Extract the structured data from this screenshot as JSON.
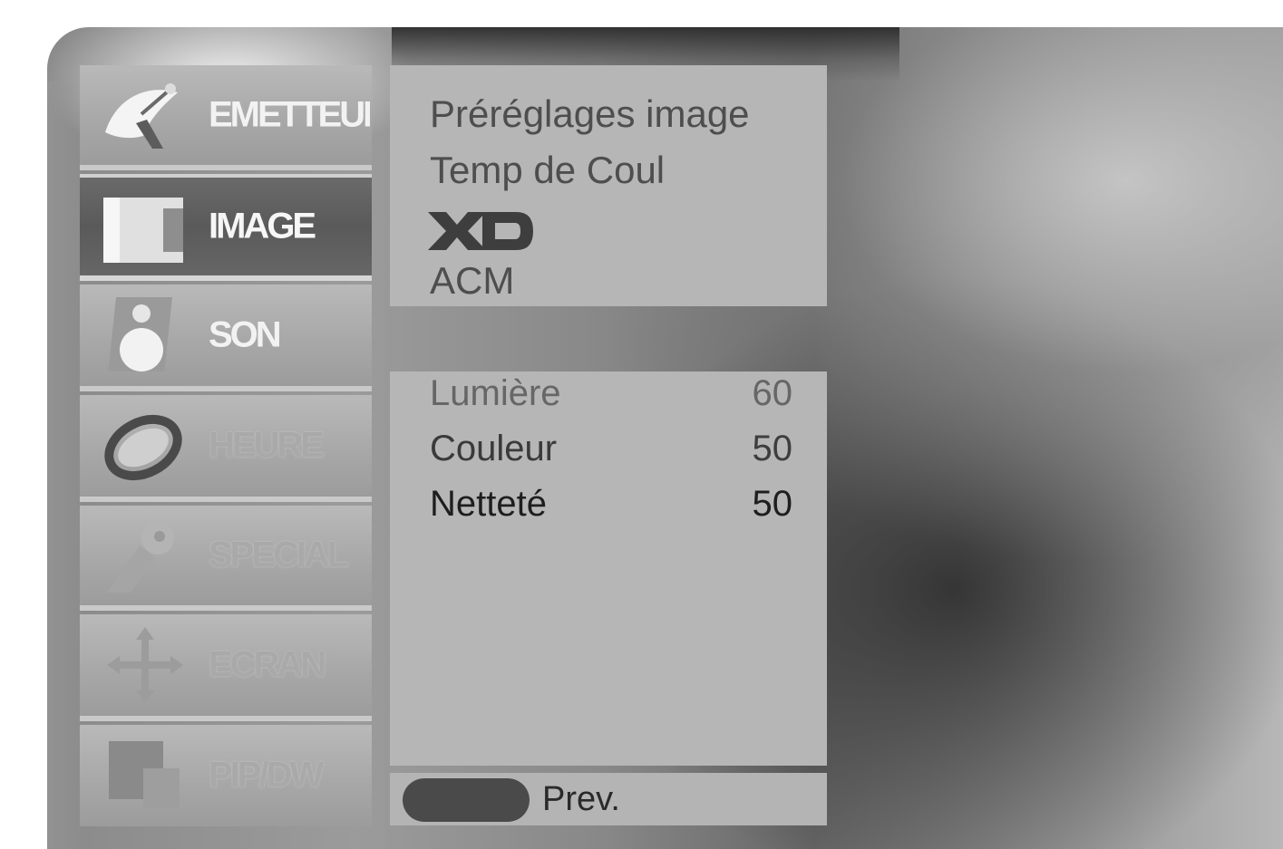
{
  "main_menu": {
    "items": [
      {
        "label": "EMETTEUR",
        "icon": "satellite-dish-icon"
      },
      {
        "label": "IMAGE",
        "icon": "picture-icon"
      },
      {
        "label": "SON",
        "icon": "speaker-icon"
      },
      {
        "label": "HEURE",
        "icon": "clock-icon"
      },
      {
        "label": "SPECIAL",
        "icon": "key-icon"
      },
      {
        "label": "ECRAN",
        "icon": "move-arrows-icon"
      },
      {
        "label": "PIP/DW",
        "icon": "pip-icon"
      }
    ],
    "active_index": 1
  },
  "image_menu": {
    "items": [
      {
        "label": "Préréglages image"
      },
      {
        "label": "Temp de Coul"
      },
      {
        "label": "XD",
        "icon": "xd-logo"
      },
      {
        "label": "ACM"
      }
    ]
  },
  "settings": {
    "rows": [
      {
        "label": "Lumière",
        "value": "60"
      },
      {
        "label": "Couleur",
        "value": "50"
      },
      {
        "label": "Netteté",
        "value": "50"
      }
    ],
    "selected_index": 2
  },
  "footer": {
    "prev_label": "Prev.",
    "prev_button_color": "#4a4a4a"
  }
}
